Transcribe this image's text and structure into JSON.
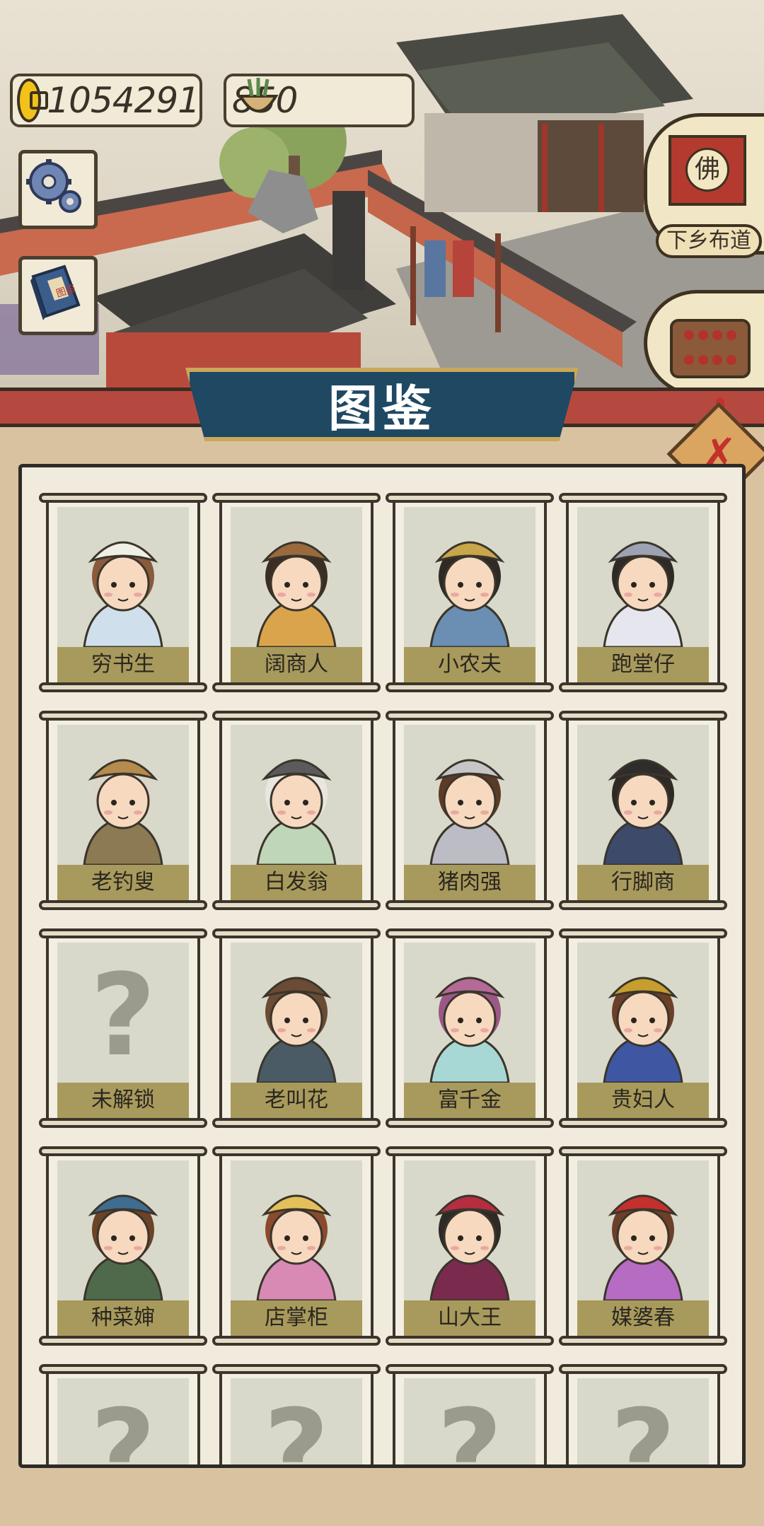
{
  "hud": {
    "coins": "1054291",
    "incense": "850",
    "temple_label": "下乡布道",
    "temple_sign": "佛",
    "book_sign": "图鉴"
  },
  "panel": {
    "title": "图鉴",
    "close_symbol": "✗",
    "locked_symbol": "?",
    "characters": [
      {
        "name": "穷书生",
        "unlocked": true,
        "hat": "#f0efe6",
        "robe": "#cfe0ec",
        "hair": "#8a5a3c"
      },
      {
        "name": "阔商人",
        "unlocked": true,
        "hat": "#9a6a3d",
        "robe": "#d9a44c",
        "hair": "#3b2d22"
      },
      {
        "name": "小农夫",
        "unlocked": true,
        "hat": "#c8a64a",
        "robe": "#6a8fb3",
        "hair": "#2f2a25"
      },
      {
        "name": "跑堂仔",
        "unlocked": true,
        "hat": "#9ea3b3",
        "robe": "#e6e7ee",
        "hair": "#2f2a25"
      },
      {
        "name": "老钓叟",
        "unlocked": true,
        "hat": "#b58b4e",
        "robe": "#8c7a52",
        "hair": "#dcd6c8"
      },
      {
        "name": "白发翁",
        "unlocked": true,
        "hat": "#5c5a5a",
        "robe": "#bfd6b8",
        "hair": "#e9e6df"
      },
      {
        "name": "猪肉强",
        "unlocked": true,
        "hat": "#c7c6c6",
        "robe": "#bcbcc4",
        "hair": "#5b3a26"
      },
      {
        "name": "行脚商",
        "unlocked": true,
        "hat": "#2f2c2c",
        "robe": "#3d4a6a",
        "hair": "#2f2a25"
      },
      {
        "name": "未解锁",
        "unlocked": false
      },
      {
        "name": "老叫花",
        "unlocked": true,
        "hat": "#6b4b34",
        "robe": "#4a5b66",
        "hair": "#6b4b34"
      },
      {
        "name": "富千金",
        "unlocked": true,
        "hat": "#b46a96",
        "robe": "#a8d8d6",
        "hair": "#9b5886"
      },
      {
        "name": "贵妇人",
        "unlocked": true,
        "hat": "#c69e2e",
        "robe": "#3f56a3",
        "hair": "#6b3f28"
      },
      {
        "name": "种菜婶",
        "unlocked": true,
        "hat": "#3f6d91",
        "robe": "#4f6a4a",
        "hair": "#6b4328"
      },
      {
        "name": "店掌柜",
        "unlocked": true,
        "hat": "#e3c05a",
        "robe": "#d88ab5",
        "hair": "#8a4a2c"
      },
      {
        "name": "山大王",
        "unlocked": true,
        "hat": "#b52d3f",
        "robe": "#7a2b4d",
        "hair": "#2f2a25"
      },
      {
        "name": "媒婆春",
        "unlocked": true,
        "hat": "#c4302c",
        "robe": "#b76cc3",
        "hair": "#6b3f28"
      },
      {
        "name": "",
        "unlocked": false
      },
      {
        "name": "",
        "unlocked": false
      },
      {
        "name": "",
        "unlocked": false
      },
      {
        "name": "",
        "unlocked": false
      }
    ]
  }
}
